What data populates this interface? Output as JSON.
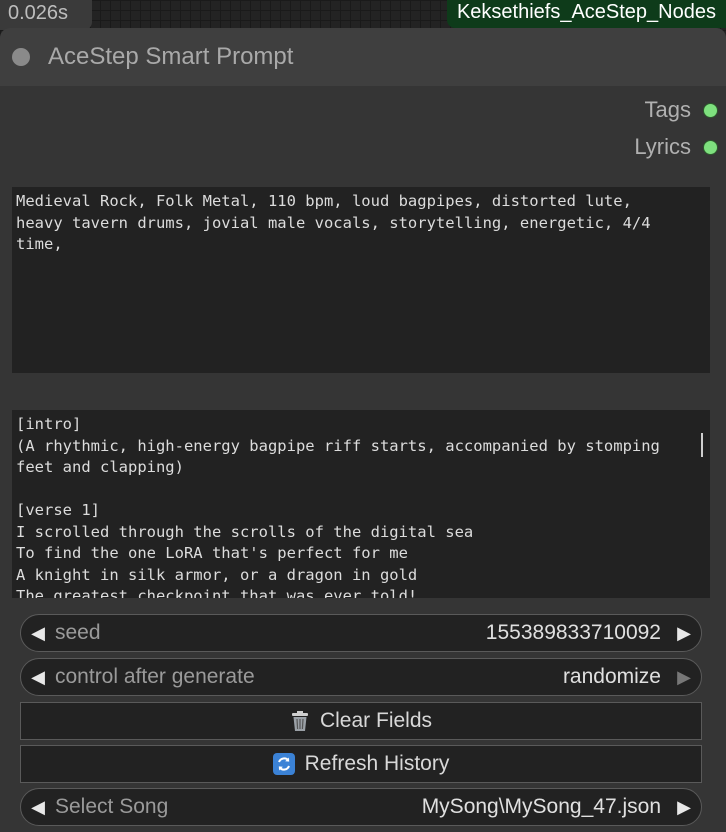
{
  "timing": "0.026s",
  "pack_name": "Keksethiefs_AceStep_Nodes",
  "node": {
    "title": "AceStep Smart Prompt",
    "outputs": [
      {
        "label": "Tags"
      },
      {
        "label": "Lyrics"
      }
    ],
    "tags_text": "Medieval Rock, Folk Metal, 110 bpm, loud bagpipes, distorted lute,\nheavy tavern drums, jovial male vocals, storytelling, energetic, 4/4\ntime,",
    "lyrics_text": "[intro]\n(A rhythmic, high-energy bagpipe riff starts, accompanied by stomping\nfeet and clapping)\n\n[verse 1]\nI scrolled through the scrolls of the digital sea\nTo find the one LoRA that's perfect for me\nA knight in silk armor, or a dragon in gold\nThe greatest checkpoint that was ever told!",
    "widgets": {
      "seed": {
        "label": "seed",
        "value": "155389833710092"
      },
      "control": {
        "label": "control after generate",
        "value": "randomize"
      },
      "clear": {
        "label": "Clear Fields",
        "icon": "trash-icon"
      },
      "refresh": {
        "label": "Refresh History",
        "icon": "refresh-icon"
      },
      "song": {
        "label": "Select Song",
        "value": "MySong\\MySong_47.json"
      }
    },
    "colors": {
      "output_dot": "#7ee07e",
      "pack_badge": "#0e3b1a"
    }
  }
}
